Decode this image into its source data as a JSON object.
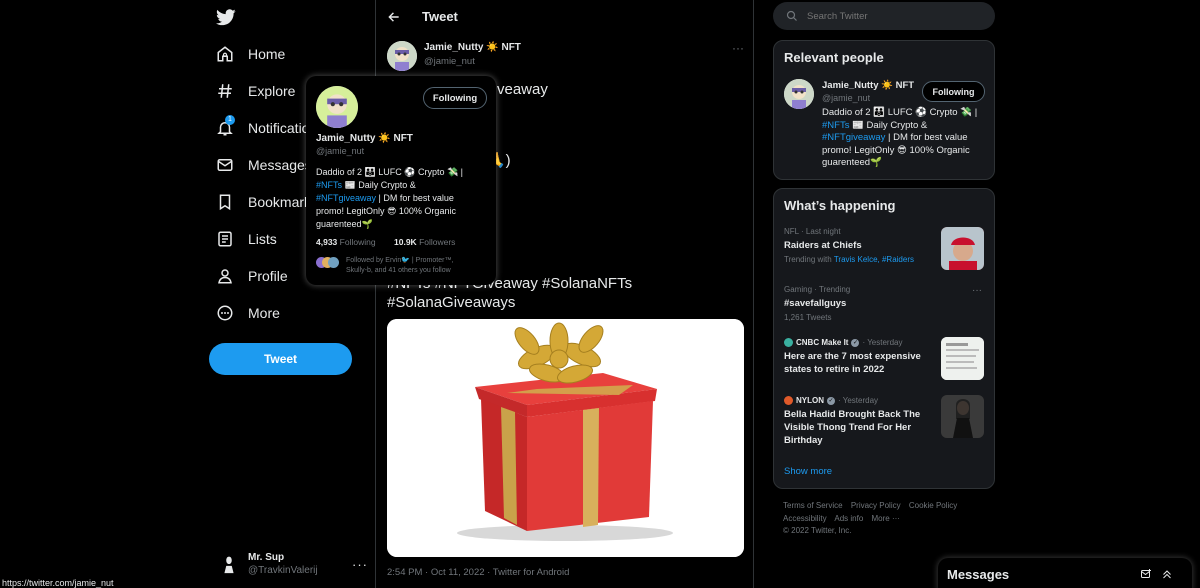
{
  "nav": {
    "items": [
      {
        "label": "Home",
        "icon": "home-icon"
      },
      {
        "label": "Explore",
        "icon": "hashtag-icon"
      },
      {
        "label": "Notifications",
        "icon": "bell-icon",
        "badge": "1"
      },
      {
        "label": "Messages",
        "icon": "envelope-icon"
      },
      {
        "label": "Bookmarks",
        "icon": "bookmark-icon"
      },
      {
        "label": "Lists",
        "icon": "list-icon"
      },
      {
        "label": "Profile",
        "icon": "person-icon"
      },
      {
        "label": "More",
        "icon": "more-circle-icon"
      }
    ],
    "tweet_button": "Tweet",
    "account": {
      "name": "Mr. Sup",
      "handle": "@TravkinValerij"
    }
  },
  "center": {
    "header_title": "Tweet",
    "author": {
      "name": "Jamie_Nutty ☀️ NFT",
      "handle": "@jamie_nut"
    },
    "text_line1_partial": "veaway",
    "text_line3_partial": "🙏)",
    "hashtags_line1": "#NFTs #NFTGiveaway #SolanaNFTs",
    "hashtags_line2": "#SolanaGiveaways",
    "meta": "2:54 PM · Oct 11, 2022 · Twitter for Android"
  },
  "hovercard": {
    "name": "Jamie_Nutty ☀️ NFT",
    "handle": "@jamie_nut",
    "follow_label": "Following",
    "bio_1": "Daddio of 2 👪 LUFC ⚽ Crypto 💸 |",
    "bio_tag1": "#NFTs",
    "bio_2": " 📰 Daily Crypto &",
    "bio_tag2": "#NFTgiveaway",
    "bio_3": " | DM for best value",
    "bio_4": "promo! LegitOnly 😎 100% Organic",
    "bio_5": "guarenteed🌱",
    "following_count": "4,933",
    "following_label": "Following",
    "followers_count": "10.9K",
    "followers_label": "Followers",
    "followed_by_1": "Followed by Ervin🐦 | Promoter™,",
    "followed_by_2": "Skully-b, and 41 others you follow"
  },
  "search": {
    "placeholder": "Search Twitter"
  },
  "relevant": {
    "title": "Relevant people",
    "name": "Jamie_Nutty ☀️ NFT",
    "handle": "@jamie_nut",
    "follow_label": "Following",
    "bio_1": "Daddio of 2 👪 LUFC ⚽ Crypto 💸 |",
    "bio_tag1": "#NFTs",
    "bio_2": " 📰 Daily Crypto &",
    "bio_tag2": "#NFTgiveaway",
    "bio_3": " | DM for best value",
    "bio_4": "promo! LegitOnly 😎 100% Organic",
    "bio_5": "guarenteed🌱"
  },
  "happening": {
    "title": "What’s happening",
    "trends": [
      {
        "context": "NFL · Last night",
        "title": "Raiders at Chiefs",
        "sub_prefix": "Trending with",
        "sub_links": "Travis Kelce, #Raiders"
      },
      {
        "context": "Gaming · Trending",
        "title": "#savefallguys",
        "count": "1,261 Tweets"
      },
      {
        "source": "CNBC Make It",
        "time": "· Yesterday",
        "title": "Here are the 7 most expensive states to retire in 2022"
      },
      {
        "source": "NYLON",
        "time": "· Yesterday",
        "title": "Bella Hadid Brought Back The Visible Thong Trend For Her Birthday"
      }
    ],
    "show_more": "Show more"
  },
  "footer": {
    "links": [
      "Terms of Service",
      "Privacy Policy",
      "Cookie Policy",
      "Accessibility",
      "Ads info",
      "More ···"
    ],
    "copyright": "© 2022 Twitter, Inc."
  },
  "messages_drawer": {
    "title": "Messages"
  },
  "status_url": "https://twitter.com/jamie_nut",
  "colors": {
    "accent": "#1d9bf0",
    "background": "#000000",
    "panel": "#16181c"
  }
}
